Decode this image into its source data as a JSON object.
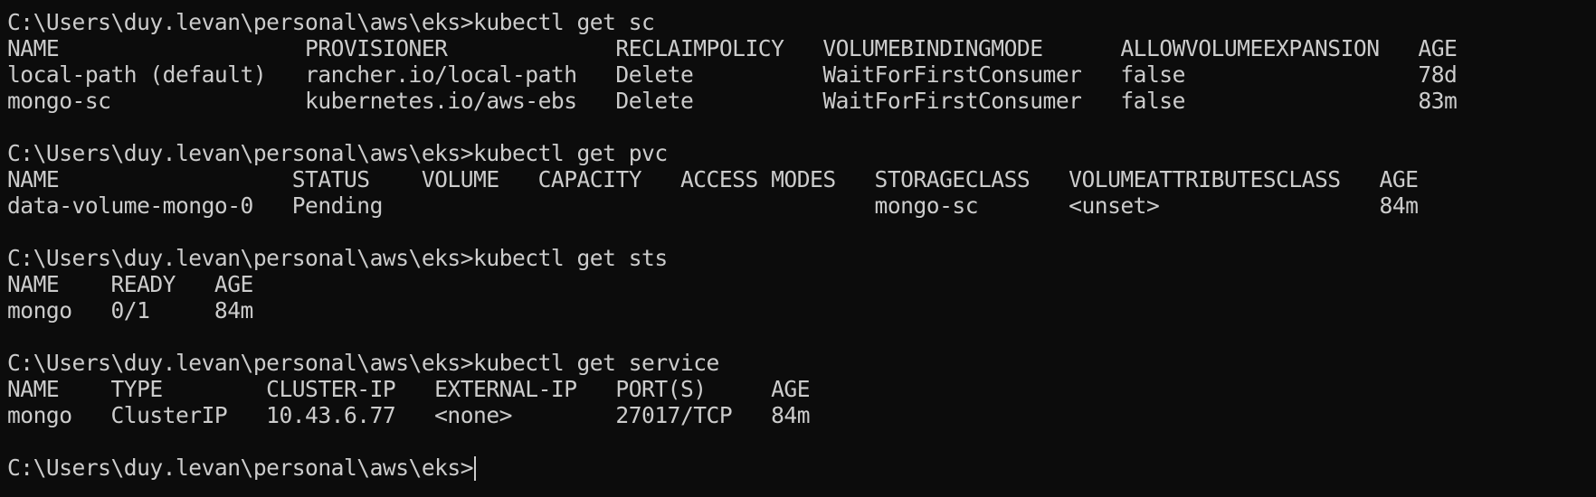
{
  "terminal": {
    "lines": [
      "C:\\Users\\duy.levan\\personal\\aws\\eks>kubectl get sc",
      "NAME                   PROVISIONER             RECLAIMPOLICY   VOLUMEBINDINGMODE      ALLOWVOLUMEEXPANSION   AGE",
      "local-path (default)   rancher.io/local-path   Delete          WaitForFirstConsumer   false                  78d",
      "mongo-sc               kubernetes.io/aws-ebs   Delete          WaitForFirstConsumer   false                  83m",
      "",
      "C:\\Users\\duy.levan\\personal\\aws\\eks>kubectl get pvc",
      "NAME                  STATUS    VOLUME   CAPACITY   ACCESS MODES   STORAGECLASS   VOLUMEATTRIBUTESCLASS   AGE",
      "data-volume-mongo-0   Pending                                      mongo-sc       <unset>                 84m",
      "",
      "C:\\Users\\duy.levan\\personal\\aws\\eks>kubectl get sts",
      "NAME    READY   AGE",
      "mongo   0/1     84m",
      "",
      "C:\\Users\\duy.levan\\personal\\aws\\eks>kubectl get service",
      "NAME    TYPE        CLUSTER-IP   EXTERNAL-IP   PORT(S)     AGE",
      "mongo   ClusterIP   10.43.6.77   <none>        27017/TCP   84m",
      ""
    ],
    "prompt": "C:\\Users\\duy.levan\\personal\\aws\\eks>"
  }
}
